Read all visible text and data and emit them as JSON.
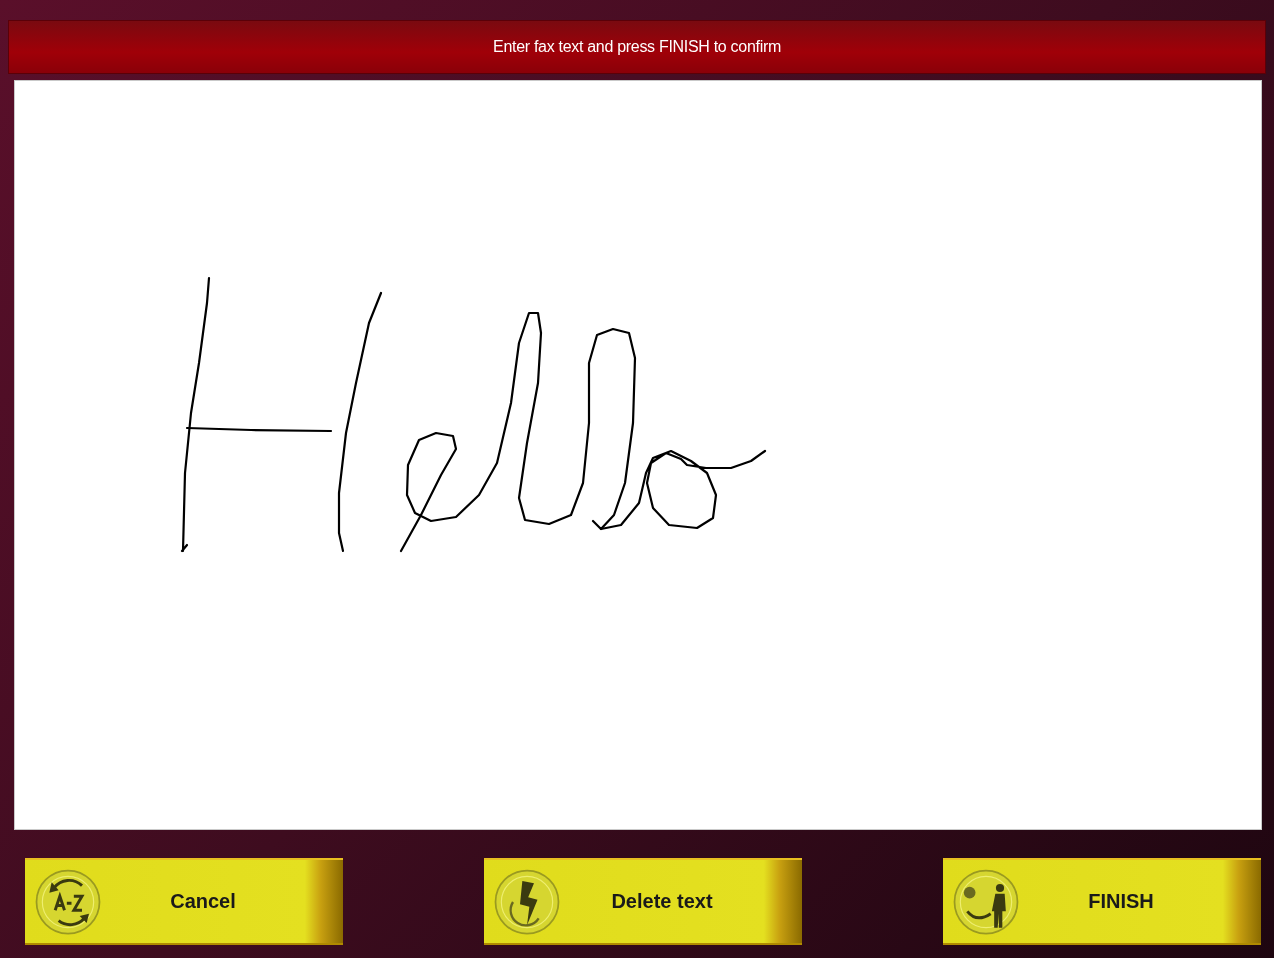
{
  "title_bar": {
    "title": "Enter fax text and press FINISH to confirm"
  },
  "canvas": {
    "kind": "ink"
  },
  "buttons": [
    {
      "label": "Cancel",
      "kind": "az"
    },
    {
      "label": "Delete text",
      "kind": "bolt"
    },
    {
      "label": "FINISH",
      "kind": "person"
    }
  ]
}
